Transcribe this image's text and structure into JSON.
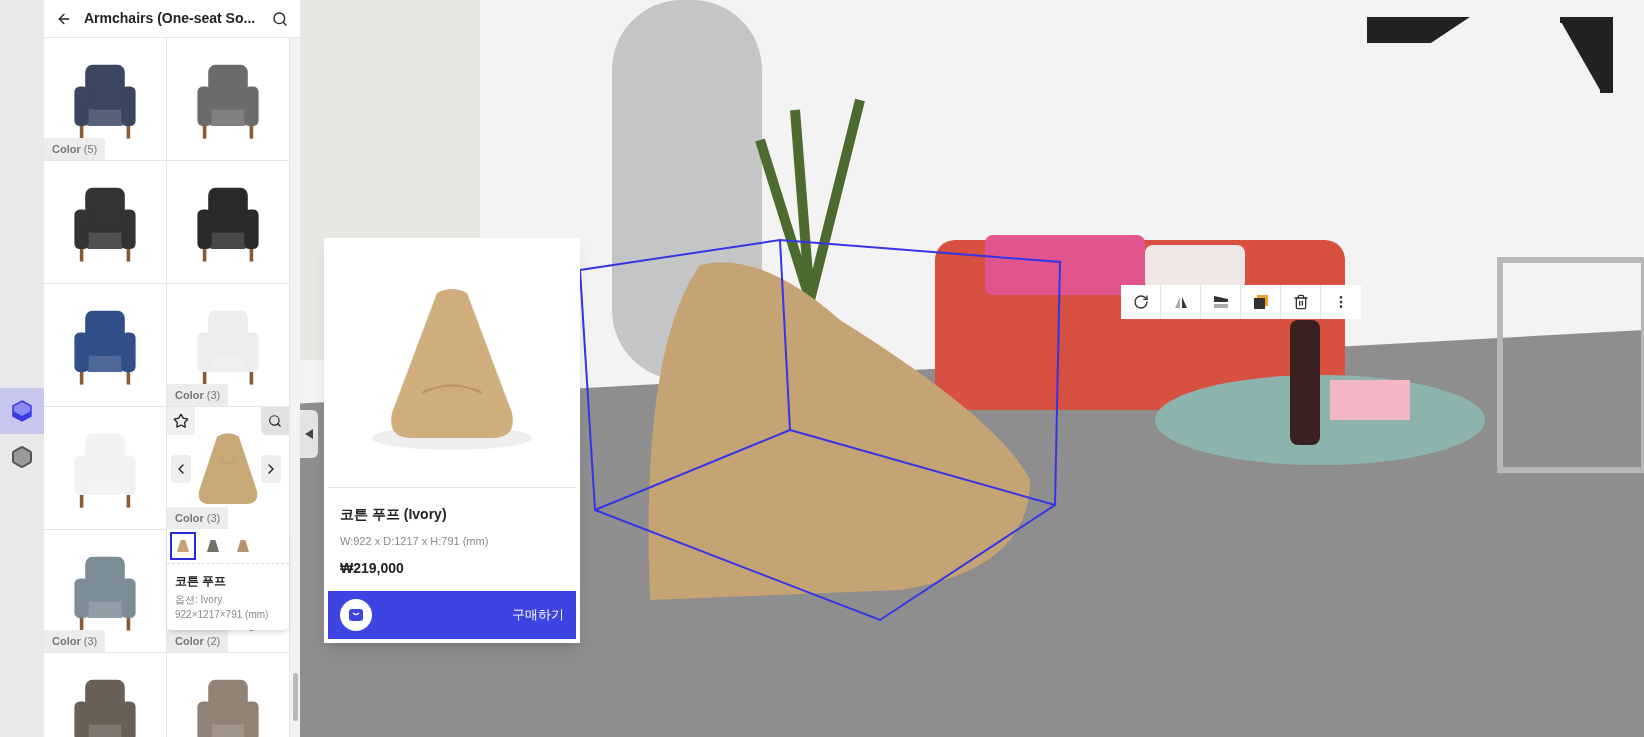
{
  "rail": {
    "items": [
      {
        "kind": "cube",
        "selected": true
      },
      {
        "kind": "hexagon",
        "selected": false
      }
    ]
  },
  "catalog": {
    "title": "Armchairs (One-seat So...",
    "items": [
      {
        "badge": "**Color** (5)",
        "hovered": false
      },
      {
        "hovered": false
      },
      {
        "hovered": false
      },
      {
        "hovered": false
      },
      {
        "hovered": false
      },
      {
        "badge": "**Color** (3)",
        "hovered": false
      },
      {
        "hovered": false
      },
      {
        "badge": "**Color** (3)",
        "hovered": true
      },
      {
        "badge": "**Color** (3)",
        "hovered": false
      },
      {
        "badge": "**Color** (2)",
        "hovered": false
      },
      {
        "hovered": false
      },
      {
        "hovered": false
      }
    ],
    "tooltip": {
      "swatches": [
        {
          "selected": true
        },
        {
          "selected": false
        },
        {
          "selected": false
        }
      ],
      "name": "코튼 푸프",
      "option": "옵션: Ivory",
      "size": "922×1217×791 (mm)"
    }
  },
  "product_card": {
    "name": "코튼 푸프 (Ivory)",
    "dimensions": "W:922 x D:1217 x H:791 (mm)",
    "price": "₩219,000",
    "buy_label": "구매하기"
  },
  "toolbar": {
    "tools": [
      {
        "kind": "rotate"
      },
      {
        "kind": "flip_h"
      },
      {
        "kind": "flip_v"
      },
      {
        "kind": "layer"
      },
      {
        "kind": "delete"
      },
      {
        "kind": "more"
      }
    ]
  }
}
